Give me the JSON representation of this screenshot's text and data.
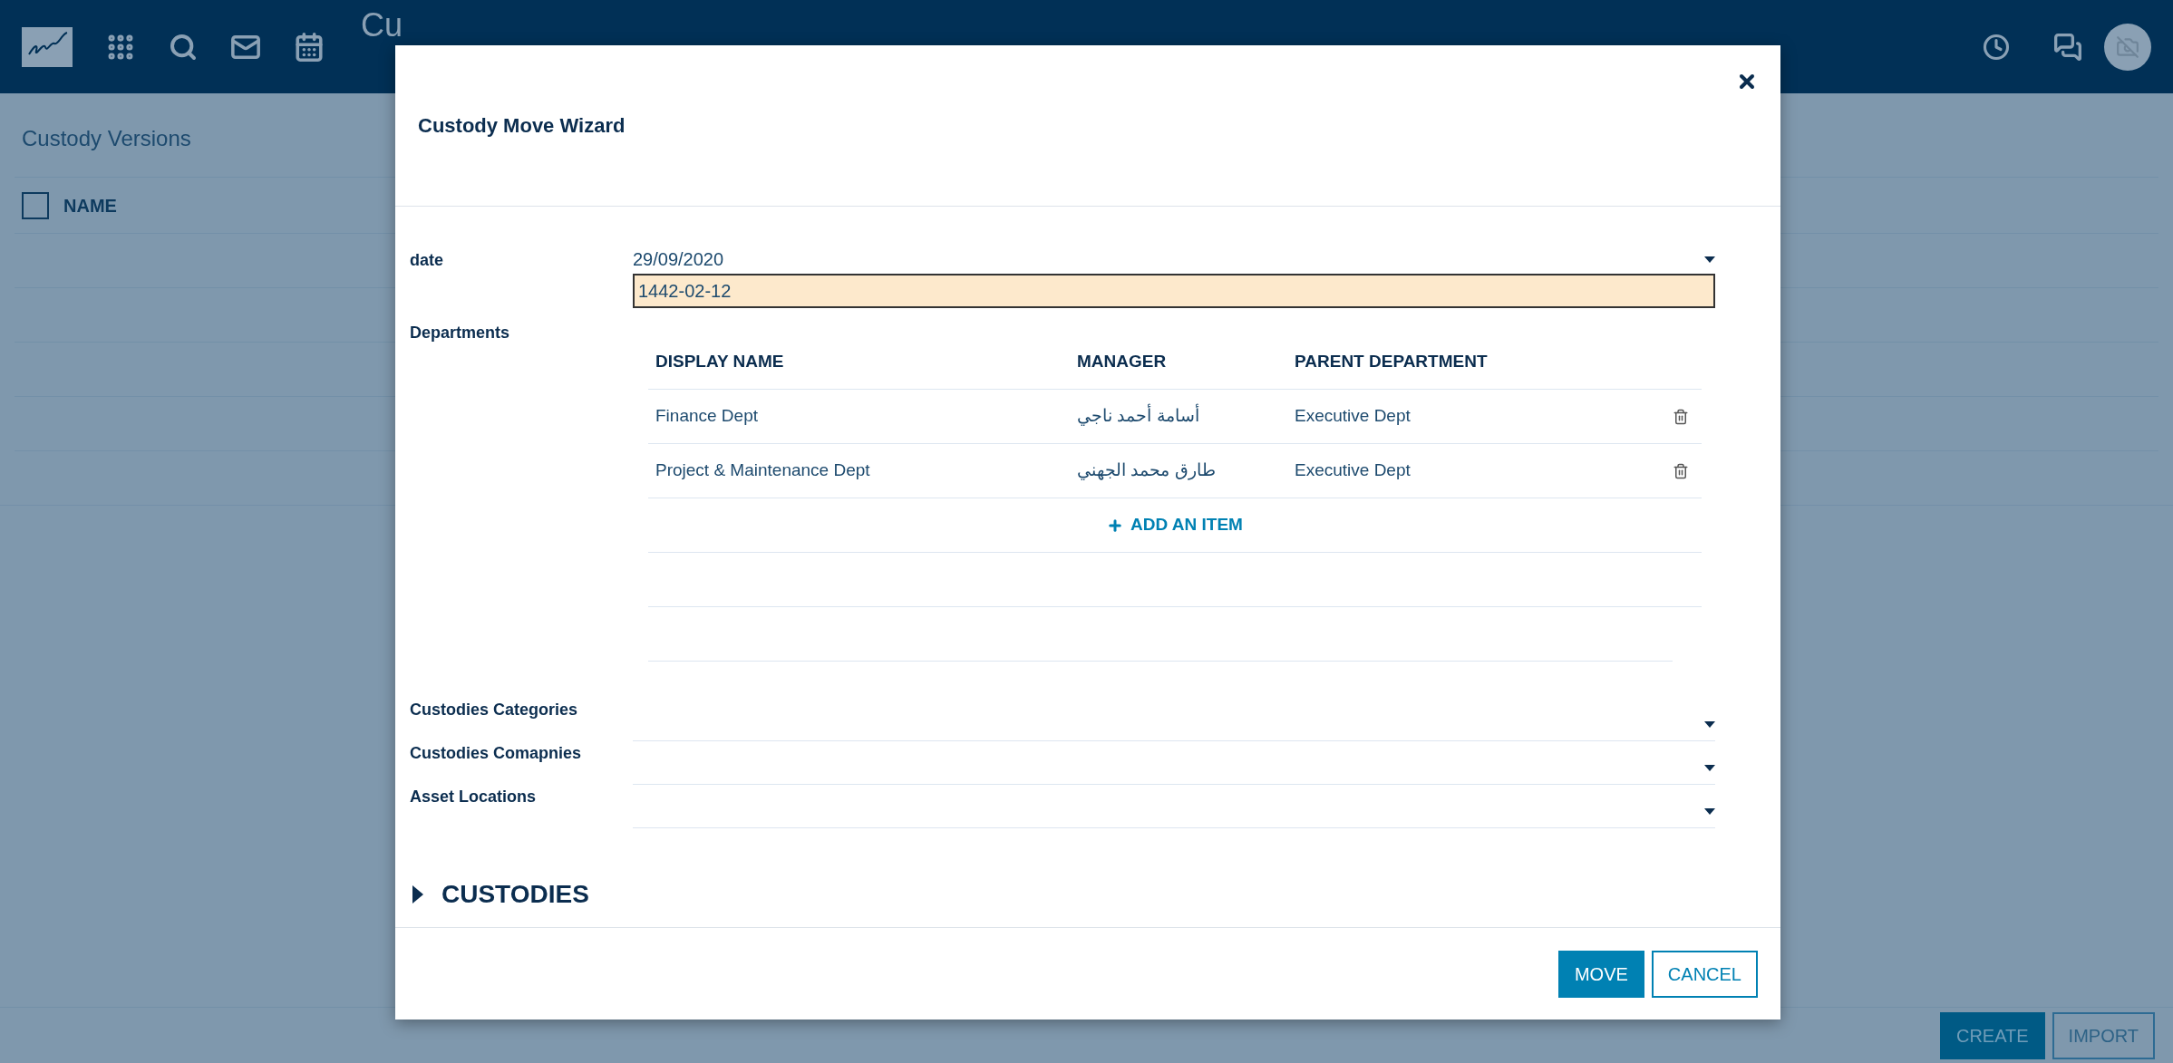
{
  "header": {
    "title": "Cu"
  },
  "page": {
    "title": "Custody Versions",
    "list_header": {
      "label": "NAME",
      "checked": false
    },
    "buttons": [
      {
        "label": "CREATE",
        "kind": "primary"
      },
      {
        "label": "IMPORT",
        "kind": "secondary"
      }
    ]
  },
  "dialog": {
    "title": "Custody Move Wizard",
    "date": {
      "label": "date",
      "value": "29/09/2020",
      "hijri": "1442-02-12"
    },
    "departments": {
      "label": "Departments",
      "columns": [
        "DISPLAY NAME",
        "MANAGER",
        "PARENT DEPARTMENT"
      ],
      "rows": [
        [
          "Finance Dept",
          "أسامة أحمد ناجي",
          "Executive Dept"
        ],
        [
          "Project & Maintenance Dept",
          "طارق محمد الجهني",
          "Executive Dept"
        ]
      ],
      "add_item": "ADD AN ITEM"
    },
    "selects": [
      {
        "label": "Custodies Categories"
      },
      {
        "label": "Custodies Comapnies"
      },
      {
        "label": "Asset Locations"
      }
    ],
    "section": {
      "label": "CUSTODIES",
      "expanded": false
    },
    "buttons": [
      {
        "label": "MOVE",
        "kind": "primary"
      },
      {
        "label": "CANCEL",
        "kind": "secondary"
      }
    ]
  }
}
